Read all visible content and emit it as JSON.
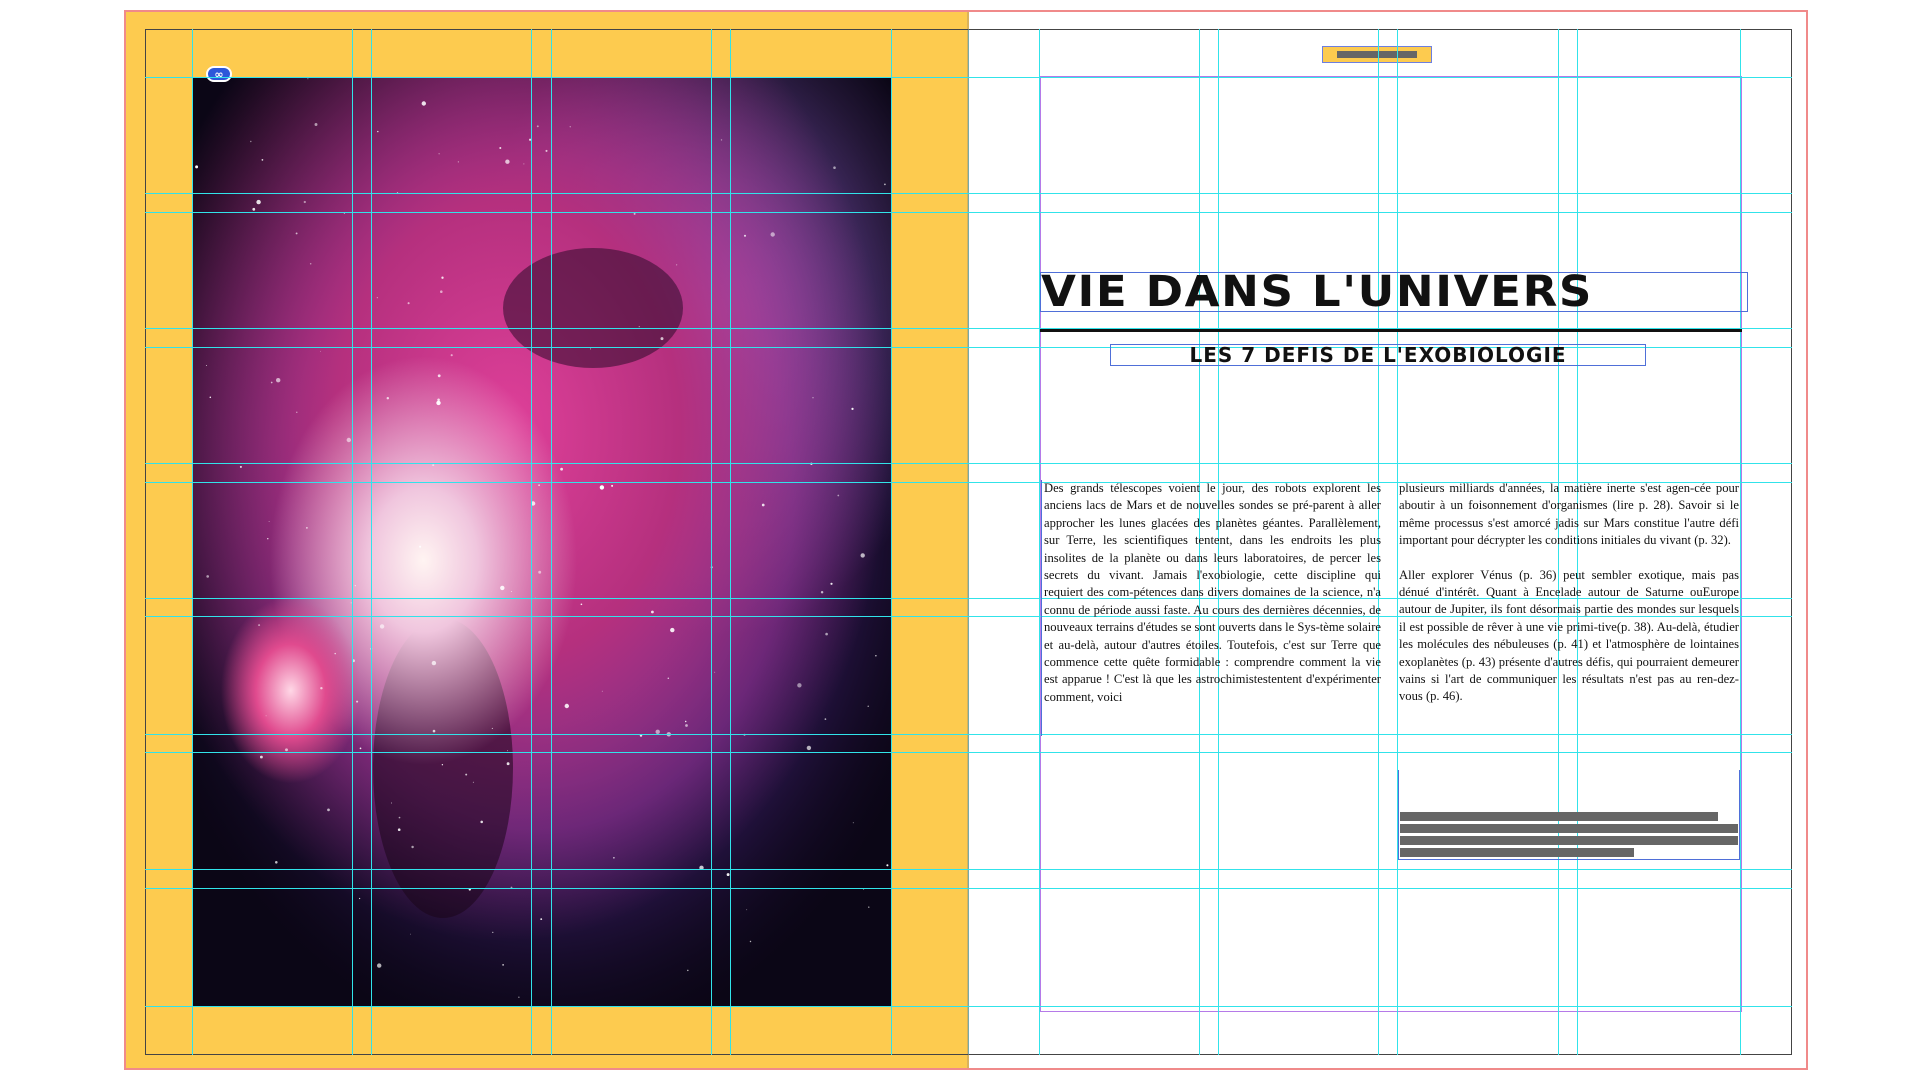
{
  "spread": {
    "left_page": {
      "image": "orion-nebula-photo",
      "link_badge": "∞"
    },
    "right_page": {
      "title": "VIE DANS L'UNIVERS",
      "subtitle": "LES 7 DEFIS DE L'EXOBIOLOGIE",
      "column_1": [
        "Des grands télescopes voient le jour, des robots explorent les anciens lacs de Mars et de nouvelles sondes se pré-parent à aller approcher les lunes glacées des planètes géantes. Parallèlement, sur Terre, les scientifiques tentent, dans les endroits les plus insolites de la planète ou dans leurs laboratoires, de percer les secrets du vivant. Jamais l'exobiologie, cette discipline qui requiert des com-pétences dans divers domaines de la science, n'a connu de période aussi faste. Au cours des dernières décennies, de nouveaux terrains d'études se sont ouverts dans le Sys-tème solaire et au-delà, autour d'autres étoiles. Toutefois, c'est sur Terre que commence cette quête formidable : comprendre comment la vie est apparue ! C'est là que les astrochimistestentent d'expérimenter comment, voici"
      ],
      "column_2": [
        "plusieurs milliards d'années, la matière inerte s'est agen-cée pour aboutir à un foisonnement d'organismes (lire p. 28). Savoir si le même processus s'est amorcé jadis sur Mars constitue l'autre défi important pour décrypter les conditions initiales du vivant (p. 32).",
        "Aller explorer Vénus (p. 36) peut sembler exotique, mais pas dénué d'intérêt. Quant à Encelade autour de Saturne ouEurope autour de Jupiter, ils font désormais partie des mondes sur lesquels il est possible de rêver à une vie primi-tive(p. 38). Au-delà, étudier les molécules des nébuleuses (p. 41) et l'atmosphère de lointaines exoplanètes (p. 43) présente d'autres défis, qui pourraient demeurer vains si l'art de communiquer les résultats n'est pas au ren-dez-vous (p. 46)."
      ]
    }
  },
  "colors": {
    "bleed": "#fdcb4f",
    "guide": "#31e3ea",
    "frame": "#4f6fd8",
    "margin": "#b57ae8",
    "page_edge": "#f08a8a"
  }
}
